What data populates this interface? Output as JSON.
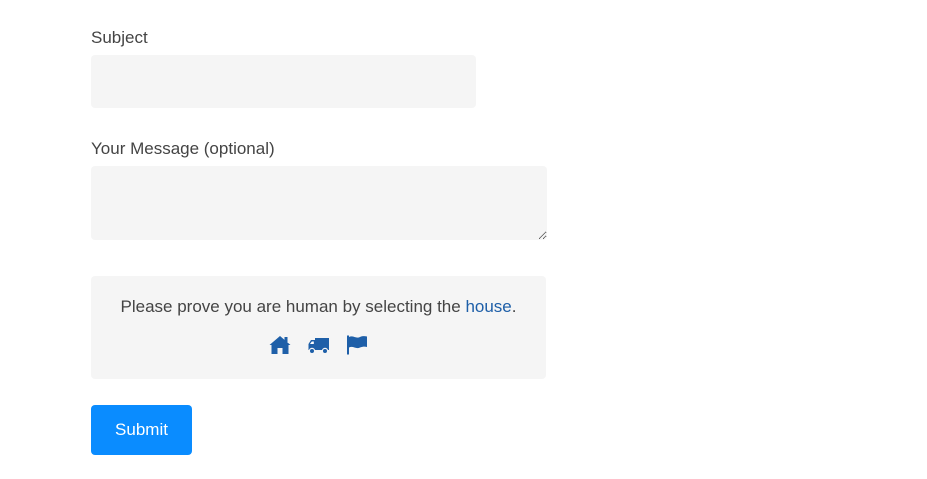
{
  "form": {
    "subject_label": "Subject",
    "subject_value": "",
    "message_label": "Your Message (optional)",
    "message_value": "",
    "captcha": {
      "text_before": "Please prove you are human by selecting the ",
      "target_word": "house",
      "text_after": ".",
      "icons": [
        "house-icon",
        "truck-icon",
        "flag-icon"
      ],
      "icon_color": "#1e5fa8"
    },
    "submit_label": "Submit",
    "submit_color": "#0a8cff"
  }
}
